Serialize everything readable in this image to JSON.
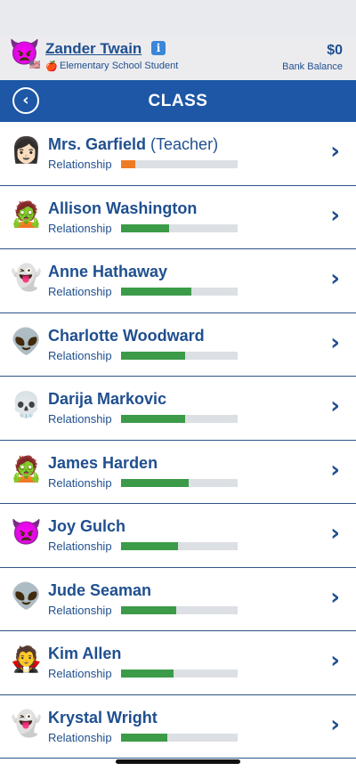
{
  "header": {
    "avatar_icon": "devil-emoji",
    "user_name": "Zander Twain",
    "status_flag_icon": "us-flag-icon",
    "status_apple_icon": "apple-icon",
    "status_text": "Elementary School Student",
    "balance": "$0",
    "balance_label": "Bank Balance"
  },
  "titlebar": {
    "title": "CLASS"
  },
  "students": [
    {
      "name": "Mrs. Garfield",
      "role": " (Teacher)",
      "avatar": "👩🏻",
      "relationship_label": "Relationship",
      "relationship_level": 0.12,
      "level_color": "orange"
    },
    {
      "name": "Allison Washington",
      "role": "",
      "avatar": "🧟",
      "relationship_label": "Relationship",
      "relationship_level": 0.41,
      "level_color": "green"
    },
    {
      "name": "Anne Hathaway",
      "role": "",
      "avatar": "👻",
      "relationship_label": "Relationship",
      "relationship_level": 0.6,
      "level_color": "green"
    },
    {
      "name": "Charlotte Woodward",
      "role": "",
      "avatar": "👽",
      "relationship_label": "Relationship",
      "relationship_level": 0.55,
      "level_color": "green"
    },
    {
      "name": "Darija Markovic",
      "role": "",
      "avatar": "💀",
      "relationship_label": "Relationship",
      "relationship_level": 0.55,
      "level_color": "green"
    },
    {
      "name": "James Harden",
      "role": "",
      "avatar": "🧟",
      "relationship_label": "Relationship",
      "relationship_level": 0.58,
      "level_color": "green"
    },
    {
      "name": "Joy Gulch",
      "role": "",
      "avatar": "👿",
      "relationship_label": "Relationship",
      "relationship_level": 0.49,
      "level_color": "green"
    },
    {
      "name": "Jude Seaman",
      "role": "",
      "avatar": "👽",
      "relationship_label": "Relationship",
      "relationship_level": 0.47,
      "level_color": "green"
    },
    {
      "name": "Kim Allen",
      "role": "",
      "avatar": "🧛",
      "relationship_label": "Relationship",
      "relationship_level": 0.45,
      "level_color": "green"
    },
    {
      "name": "Krystal Wright",
      "role": "",
      "avatar": "👻",
      "relationship_label": "Relationship",
      "relationship_level": 0.4,
      "level_color": "green"
    }
  ],
  "colors": {
    "brand_blue": "#1d57a6",
    "text_blue": "#1f4f8f",
    "bar_green": "#3c9b48",
    "bar_orange": "#ef7a24",
    "bar_track": "#dcdfe3"
  }
}
